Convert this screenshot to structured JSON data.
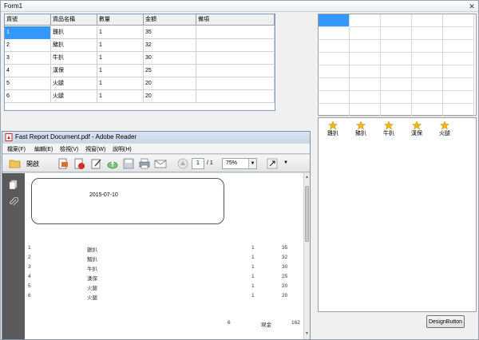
{
  "form1": {
    "title": "Form1",
    "close_glyph": "✕"
  },
  "grid": {
    "columns": [
      "貨號",
      "貨品名稱",
      "數量",
      "金額",
      "備項"
    ],
    "rows": [
      [
        "1",
        "雞扒",
        "1",
        "35",
        ""
      ],
      [
        "2",
        "豬扒",
        "1",
        "32",
        ""
      ],
      [
        "3",
        "牛扒",
        "1",
        "30",
        ""
      ],
      [
        "4",
        "漢保",
        "1",
        "25",
        ""
      ],
      [
        "5",
        "火腿",
        "1",
        "20",
        ""
      ],
      [
        "6",
        "火腿",
        "1",
        "20",
        ""
      ]
    ]
  },
  "products": {
    "items": [
      "雞扒",
      "豬扒",
      "牛扒",
      "漢保",
      "火腿"
    ],
    "icon": "star-icon",
    "icon_color": "#f2b51c"
  },
  "design_button_label": "DesignButton",
  "reader": {
    "title": "Fast Report Document.pdf - Adobe Reader",
    "menu": [
      "檔案(F)",
      "編輯(E)",
      "檢視(V)",
      "視窗(W)",
      "說明(H)"
    ],
    "open_label": "開啟",
    "page_current": "1",
    "page_total": "/ 1",
    "zoom": "75%",
    "zoom_arrow": "▼",
    "overflow": "▼",
    "scroll_up": "▲",
    "scroll_down": "▼"
  },
  "report": {
    "date": "2015-07-10",
    "rows": [
      [
        "1",
        "雞扒",
        "1",
        "35"
      ],
      [
        "2",
        "豬扒",
        "1",
        "32"
      ],
      [
        "3",
        "牛扒",
        "1",
        "30"
      ],
      [
        "4",
        "漢保",
        "1",
        "25"
      ],
      [
        "5",
        "火腿",
        "1",
        "20"
      ],
      [
        "6",
        "火腿",
        "1",
        "20"
      ]
    ],
    "footer_count": "6",
    "footer_label": "現金",
    "footer_total": "162"
  },
  "colors": {
    "selection": "#3399ff",
    "pdf_red": "#d12b2b",
    "side_pane": "#5a5a5a"
  }
}
